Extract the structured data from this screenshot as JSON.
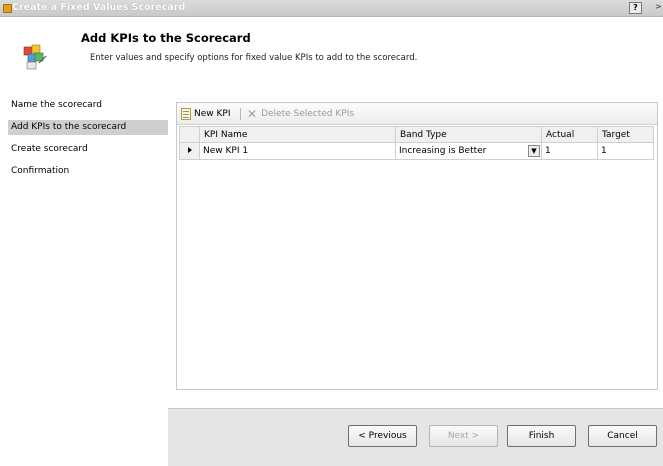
{
  "window": {
    "title": "Create a Fixed Values Scorecard",
    "help_label": "?",
    "edge_label": ">"
  },
  "header": {
    "title": "Add KPIs to the Scorecard",
    "subtitle": "Enter values and specify options for fixed value KPIs to add to the scorecard."
  },
  "nav": {
    "items": [
      {
        "label": "Name the scorecard",
        "active": false
      },
      {
        "label": "Add KPIs to the scorecard",
        "active": true
      },
      {
        "label": "Create scorecard",
        "active": false
      },
      {
        "label": "Confirmation",
        "active": false
      }
    ]
  },
  "toolbar": {
    "new_kpi_label": "New KPI",
    "delete_label": "Delete Selected KPIs"
  },
  "table": {
    "columns": [
      "KPI Name",
      "Band Type",
      "Actual",
      "Target"
    ],
    "rows": [
      {
        "kpi_name": "New KPI 1",
        "band_type": "Increasing is Better",
        "actual": "1",
        "target": "1"
      }
    ]
  },
  "buttons": {
    "previous": "< Previous",
    "next": "Next >",
    "finish": "Finish",
    "cancel": "Cancel"
  },
  "icons": {
    "app": "scorecard-app-icon",
    "wizard": "wizard-icon",
    "new_kpi": "new-document-icon",
    "delete": "delete-x-icon",
    "row_indicator": "row-pointer-icon",
    "dropdown": "chevron-down-icon"
  }
}
